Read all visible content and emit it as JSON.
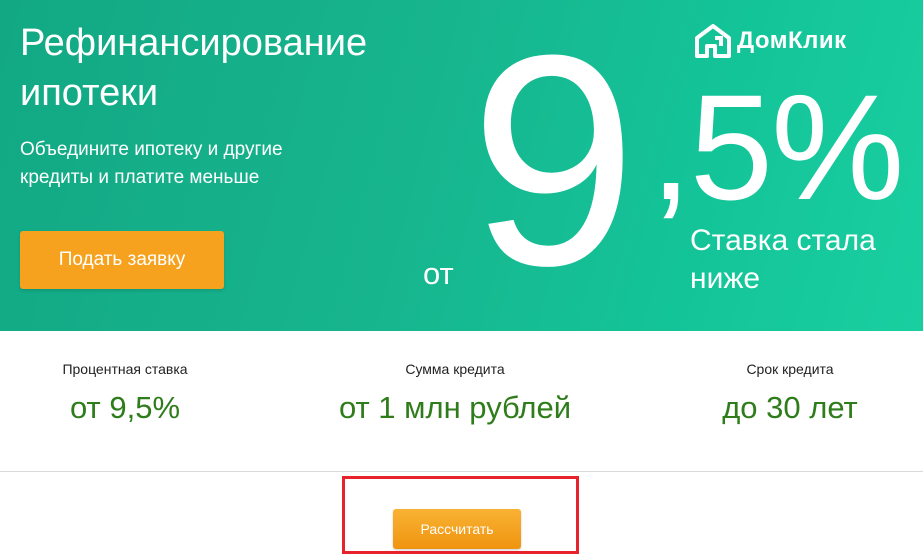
{
  "hero": {
    "title": "Рефинансирование ипотеки",
    "subtitle": "Объедините ипотеку и другие кредиты и платите меньше",
    "apply_label": "Подать заявку",
    "rate_prefix": "от",
    "rate_integer": "9",
    "rate_fraction": ",5%",
    "rate_note": "Ставка стала ниже",
    "brand_name": "ДомКлик",
    "colors": {
      "background": "#17b58e",
      "button": "#f6a21e"
    }
  },
  "stats": [
    {
      "label": "Процентная ставка",
      "value": "от 9,5%"
    },
    {
      "label": "Сумма кредита",
      "value": "от 1 млн рублей"
    },
    {
      "label": "Срок кредита",
      "value": "до 30 лет"
    }
  ],
  "calculator": {
    "button_label": "Рассчитать",
    "highlight_color": "#e8222a",
    "value_color": "#2e7d1a"
  }
}
